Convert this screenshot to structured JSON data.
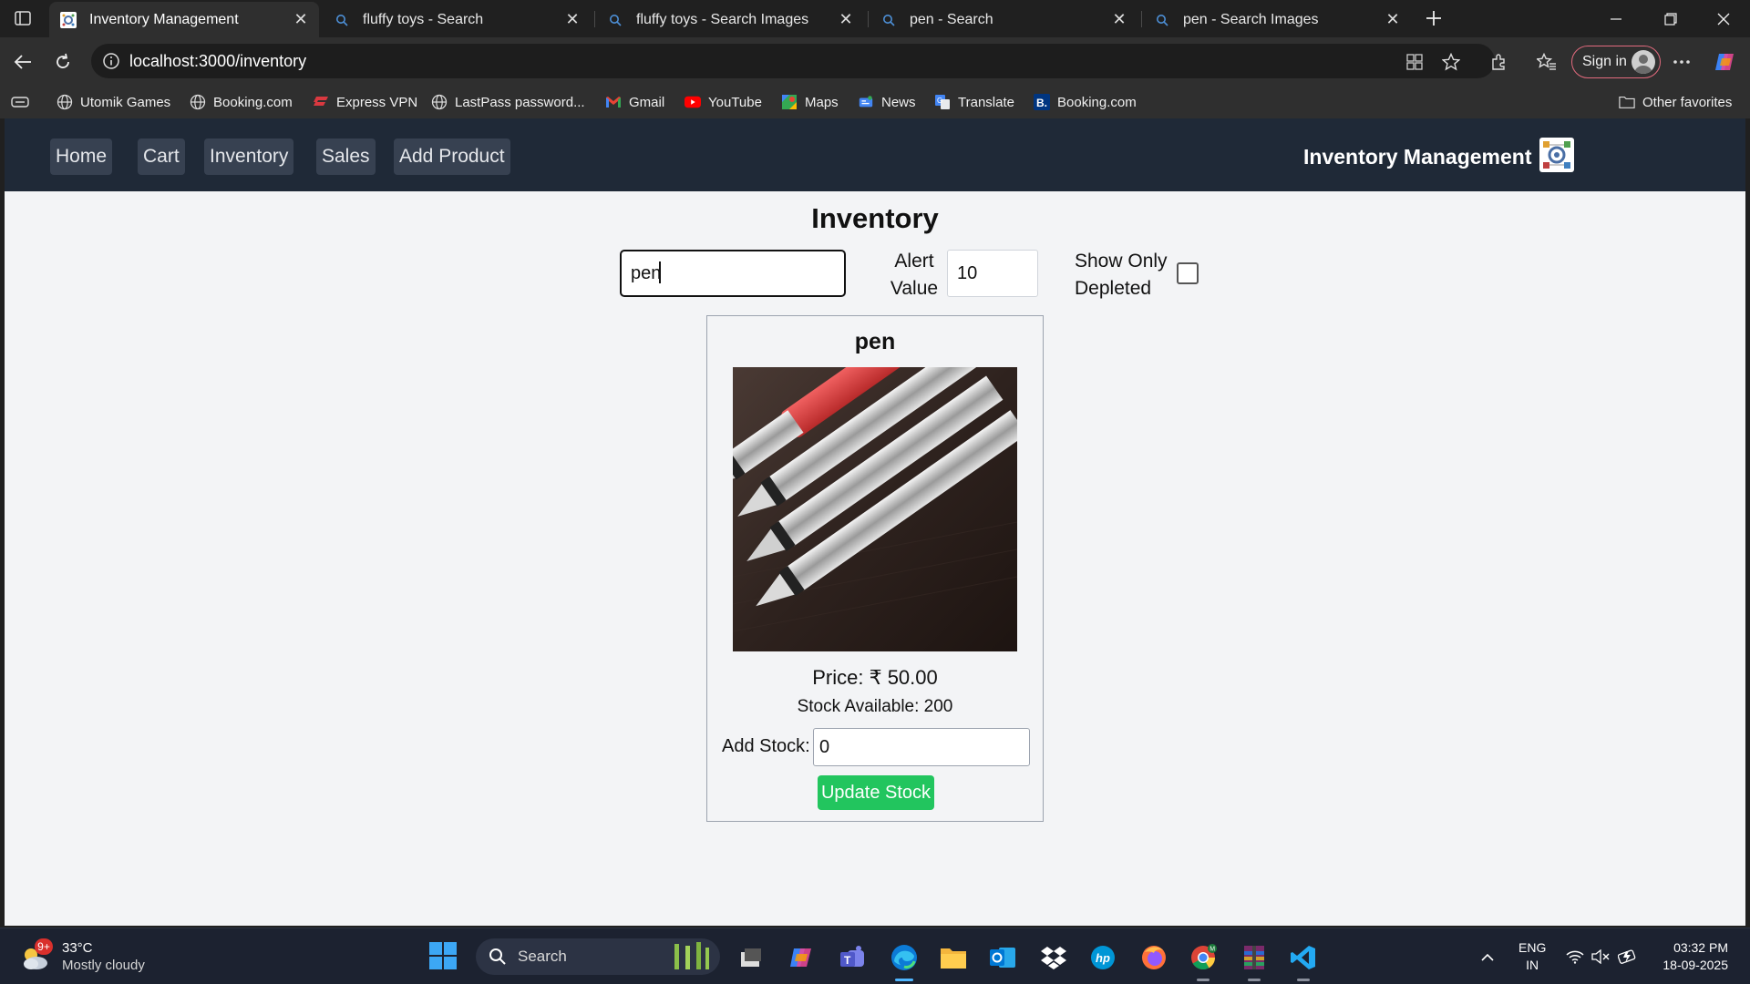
{
  "browser": {
    "tabs": [
      {
        "title": "Inventory Management",
        "active": true,
        "icon": "app-logo-icon"
      },
      {
        "title": "fluffy toys - Search",
        "active": false,
        "icon": "search-icon"
      },
      {
        "title": "fluffy toys - Search Images",
        "active": false,
        "icon": "search-icon"
      },
      {
        "title": "pen - Search",
        "active": false,
        "icon": "search-icon"
      },
      {
        "title": "pen - Search Images",
        "active": false,
        "icon": "search-icon"
      }
    ],
    "url": "localhost:3000/inventory",
    "sign_in_label": "Sign in",
    "favorites": [
      {
        "label": "Utomik Games",
        "icon": "globe-icon"
      },
      {
        "label": "Booking.com",
        "icon": "globe-icon"
      },
      {
        "label": "Express VPN",
        "icon": "expressvpn-icon"
      },
      {
        "label": "LastPass password...",
        "icon": "globe-icon"
      },
      {
        "label": "Gmail",
        "icon": "gmail-icon"
      },
      {
        "label": "YouTube",
        "icon": "youtube-icon"
      },
      {
        "label": "Maps",
        "icon": "maps-icon"
      },
      {
        "label": "News",
        "icon": "news-icon"
      },
      {
        "label": "Translate",
        "icon": "translate-icon"
      },
      {
        "label": "Booking.com",
        "icon": "booking-icon"
      }
    ],
    "other_favorites_label": "Other favorites"
  },
  "app": {
    "nav": [
      "Home",
      "Cart",
      "Inventory",
      "Sales",
      "Add Product"
    ],
    "brand": "Inventory Management",
    "page_title": "Inventory",
    "search_value": "pen",
    "alert_label": "Alert Value",
    "alert_value": "10",
    "depleted_label": "Show Only Depleted",
    "depleted_checked": false,
    "products": [
      {
        "name": "pen",
        "image": "fountain-pens-photo",
        "price_text": "Price: ₹ 50.00",
        "stock_text": "Stock Available: 200",
        "add_stock_label": "Add Stock:",
        "add_stock_value": "0",
        "update_label": "Update Stock"
      }
    ]
  },
  "taskbar": {
    "weather_temp": "33°C",
    "weather_cond": "Mostly cloudy",
    "weather_badge": "9+",
    "search_placeholder": "Search",
    "lang_1": "ENG",
    "lang_2": "IN",
    "time": "03:32 PM",
    "date": "18-09-2025"
  },
  "colors": {
    "app_nav_bg": "#1f2937",
    "nav_button_bg": "#374151",
    "update_button": "#22c55e",
    "page_bg": "#f3f4f6"
  }
}
